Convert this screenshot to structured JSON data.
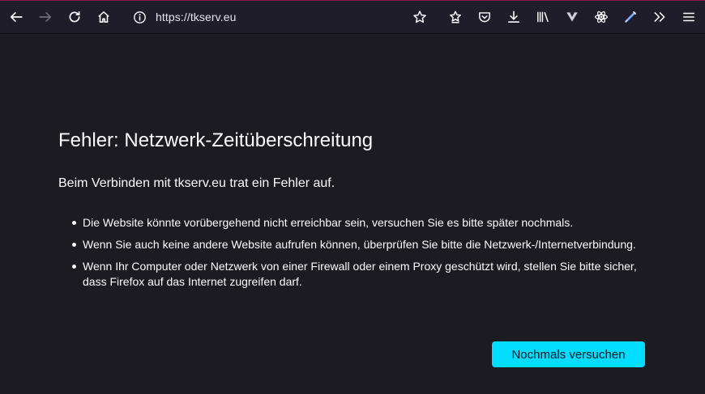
{
  "browser": {
    "url": "https://tkserv.eu",
    "accent_color": "#8a1a4a",
    "icons": [
      "back-icon",
      "forward-icon",
      "reload-icon",
      "home-icon",
      "info-icon",
      "bookmark-star-icon",
      "reader-icon",
      "pocket-icon",
      "downloads-icon",
      "library-icon",
      "extension-v-icon",
      "extension-atom-icon",
      "extension-pen-icon",
      "overflow-icon",
      "menu-icon"
    ]
  },
  "page": {
    "title": "Fehler: Netzwerk-Zeitüberschreitung",
    "intro": "Beim Verbinden mit tkserv.eu trat ein Fehler auf.",
    "items": [
      "Die Website könnte vorübergehend nicht erreichbar sein, versuchen Sie es bitte später nochmals.",
      "Wenn Sie auch keine andere Website aufrufen können, überprüfen Sie bitte die Netzwerk-/Internetverbindung.",
      "Wenn Ihr Computer oder Netzwerk von einer Firewall oder einem Proxy geschützt wird, stellen Sie bitte sicher, dass Firefox auf das Internet zugreifen darf."
    ],
    "retry_label": "Nochmals versuchen",
    "button_color": "#00ddff"
  }
}
